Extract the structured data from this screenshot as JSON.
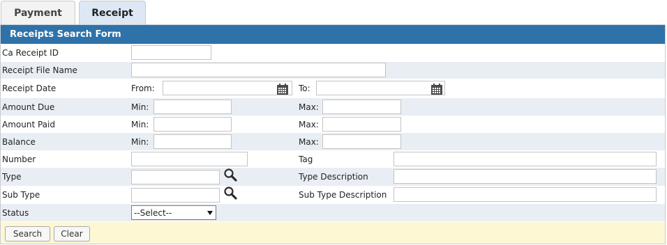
{
  "tabs": [
    {
      "label": "Payment"
    },
    {
      "label": "Receipt"
    }
  ],
  "form": {
    "title": "Receipts Search Form",
    "fields": {
      "ca_receipt_id": {
        "label": "Ca Receipt ID",
        "value": ""
      },
      "receipt_file_name": {
        "label": "Receipt File Name",
        "value": ""
      },
      "receipt_date": {
        "label": "Receipt Date",
        "from_label": "From:",
        "to_label": "To:",
        "from_value": "",
        "to_value": ""
      },
      "amount_due": {
        "label": "Amount Due",
        "min_label": "Min:",
        "max_label": "Max:"
      },
      "amount_paid": {
        "label": "Amount Paid",
        "min_label": "Min:",
        "max_label": "Max:"
      },
      "balance": {
        "label": "Balance",
        "min_label": "Min:",
        "max_label": "Max:"
      },
      "number": {
        "label": "Number",
        "value": ""
      },
      "tag": {
        "label": "Tag",
        "value": ""
      },
      "type": {
        "label": "Type",
        "value": ""
      },
      "type_description": {
        "label": "Type Description",
        "value": ""
      },
      "sub_type": {
        "label": "Sub Type",
        "value": ""
      },
      "sub_type_description": {
        "label": "Sub Type Description",
        "value": ""
      },
      "status": {
        "label": "Status",
        "selected": "--Select--"
      }
    },
    "buttons": {
      "search": "Search",
      "clear": "Clear"
    }
  },
  "colors": {
    "header_bg": "#2e72a9",
    "alt_row_bg": "#e9eef4",
    "footer_bg": "#fdf7d4",
    "active_tab_bg": "#dde8f4"
  },
  "icons": {
    "calendar": "calendar-icon",
    "lookup": "magnifier-icon",
    "dropdown": "caret-down-icon"
  }
}
